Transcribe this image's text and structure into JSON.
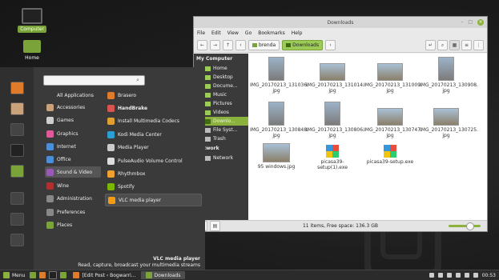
{
  "desktop": {
    "icons": [
      {
        "label": "Computer",
        "icon": "computer-icon"
      },
      {
        "label": "Home",
        "icon": "home-folder-icon"
      }
    ]
  },
  "file_manager": {
    "title": "Downloads",
    "menu": [
      "File",
      "Edit",
      "View",
      "Go",
      "Bookmarks",
      "Help"
    ],
    "breadcrumbs": [
      "brenda",
      "Downloads"
    ],
    "sidebar": {
      "heading": "My Computer",
      "items": [
        "Home",
        "Desktop",
        "Docume...",
        "Music",
        "Pictures",
        "Videos",
        "Downlo...",
        "File Syst...",
        "Trash"
      ],
      "network_heading": "Network",
      "network_items": [
        "Network"
      ]
    },
    "files": [
      {
        "name": "IMG_20170213_131036.\njpg",
        "kind": "v"
      },
      {
        "name": "IMG_20170213_131014.\njpg",
        "kind": "h"
      },
      {
        "name": "IMG_20170213_131009.\njpg",
        "kind": "h"
      },
      {
        "name": "IMG_20170213_130908.\njpg",
        "kind": "v"
      },
      {
        "name": "IMG_20170213_130848.\njpg",
        "kind": "v"
      },
      {
        "name": "IMG_20170213_130806.\njpg",
        "kind": "v"
      },
      {
        "name": "IMG_20170213_130747.\njpg",
        "kind": "h"
      },
      {
        "name": "IMG_20170213_130725.\njpg",
        "kind": "h"
      },
      {
        "name": "95 windows.jpg",
        "kind": "h"
      },
      {
        "name": "picasa39-setup(1).exe",
        "kind": "exe"
      },
      {
        "name": "picasa39-setup.exe",
        "kind": "exe"
      }
    ],
    "status": "11 items, Free space: 136.3 GB"
  },
  "start_menu": {
    "search_placeholder": "",
    "categories": [
      {
        "label": "All Applications",
        "color": "#3a3a3a"
      },
      {
        "label": "Accessories",
        "color": "#c9a27a"
      },
      {
        "label": "Games",
        "color": "#cfcfcf"
      },
      {
        "label": "Graphics",
        "color": "#e05a9a"
      },
      {
        "label": "Internet",
        "color": "#4a90d9"
      },
      {
        "label": "Office",
        "color": "#4a90d9"
      },
      {
        "label": "Sound & Video",
        "color": "#9b59b6"
      },
      {
        "label": "Wine",
        "color": "#b03030"
      },
      {
        "label": "Administration",
        "color": "#888888"
      },
      {
        "label": "Preferences",
        "color": "#888888"
      },
      {
        "label": "Places",
        "color": "#7aa33a"
      }
    ],
    "apps": [
      {
        "label": "Brasero",
        "color": "#e07b2a"
      },
      {
        "label": "HandBrake",
        "color": "#d9534f",
        "bold": true
      },
      {
        "label": "Install Multimedia Codecs",
        "color": "#e0a030"
      },
      {
        "label": "Kodi Media Center",
        "color": "#2a9fd6"
      },
      {
        "label": "Media Player",
        "color": "#cccccc"
      },
      {
        "label": "PulseAudio Volume Control",
        "color": "#dddddd"
      },
      {
        "label": "Rhythmbox",
        "color": "#f0a030"
      },
      {
        "label": "Spotify",
        "color": "#7ab800"
      },
      {
        "label": "VLC media player",
        "color": "#f39c12"
      }
    ],
    "description_title": "VLC media player",
    "description_text": "Read, capture, broadcast your multimedia streams"
  },
  "taskbar": {
    "menu_label": "Menu",
    "tasks": [
      "[Edit Post ‹ Bogwarri...",
      "Downloads"
    ],
    "clock": "00:53"
  }
}
